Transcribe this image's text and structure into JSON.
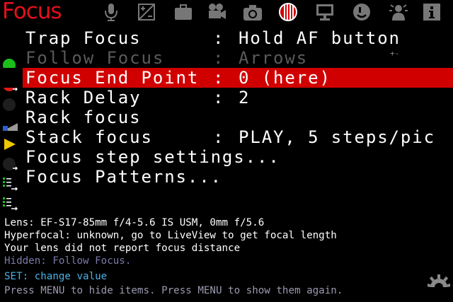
{
  "header": {
    "title": "Focus",
    "tabs": [
      {
        "icon": "microphone-icon"
      },
      {
        "icon": "exposure-icon"
      },
      {
        "icon": "briefcase-icon"
      },
      {
        "icon": "movie-camera-icon"
      },
      {
        "icon": "photo-camera-icon"
      },
      {
        "icon": "focus-icon",
        "active": true
      },
      {
        "icon": "display-icon"
      },
      {
        "icon": "smiley-icon"
      },
      {
        "icon": "debug-icon"
      },
      {
        "icon": "info-icon"
      }
    ]
  },
  "menu": {
    "items": [
      {
        "label": "Trap Focus",
        "separator": ":",
        "value": "Hold AF button",
        "icon": "green-dot-icon"
      },
      {
        "label": "Follow Focus",
        "separator": ":",
        "value": "Arrows",
        "icon": "red-dot-icon",
        "hint": "+-"
      },
      {
        "label": "Focus End Point",
        "separator": ":",
        "value": "0 (here)",
        "icon": "dark-dot-icon"
      },
      {
        "label": "Rack Delay",
        "separator": ":",
        "value": "2",
        "icon": "slider-icon"
      },
      {
        "label": "Rack focus",
        "separator": "",
        "value": "",
        "icon": "play-icon"
      },
      {
        "label": "Stack focus",
        "separator": ":",
        "value": "PLAY, 5 steps/pic",
        "icon": "dark-dot-icon"
      },
      {
        "label": "Focus step settings...",
        "separator": "",
        "value": "",
        "icon": "submenu-icon"
      },
      {
        "label": "Focus Patterns...",
        "separator": "",
        "value": "",
        "icon": "submenu-icon"
      }
    ]
  },
  "info": {
    "lens": "Lens: EF-S17-85mm f/4-5.6 IS USM, 0mm f/5.6",
    "hyperfocal": "Hyperfocal: unknown, go to LiveView to get focal length",
    "distance": "Your lens did not report focus distance",
    "hidden": "Hidden: Follow Focus.",
    "set_hint": "SET: change value",
    "menu_hint": "Press MENU to hide items. Press MENU to show them again."
  },
  "colors": {
    "title": "#e2101a",
    "selection": "#d10000",
    "set_hint": "#4ab3e8"
  }
}
